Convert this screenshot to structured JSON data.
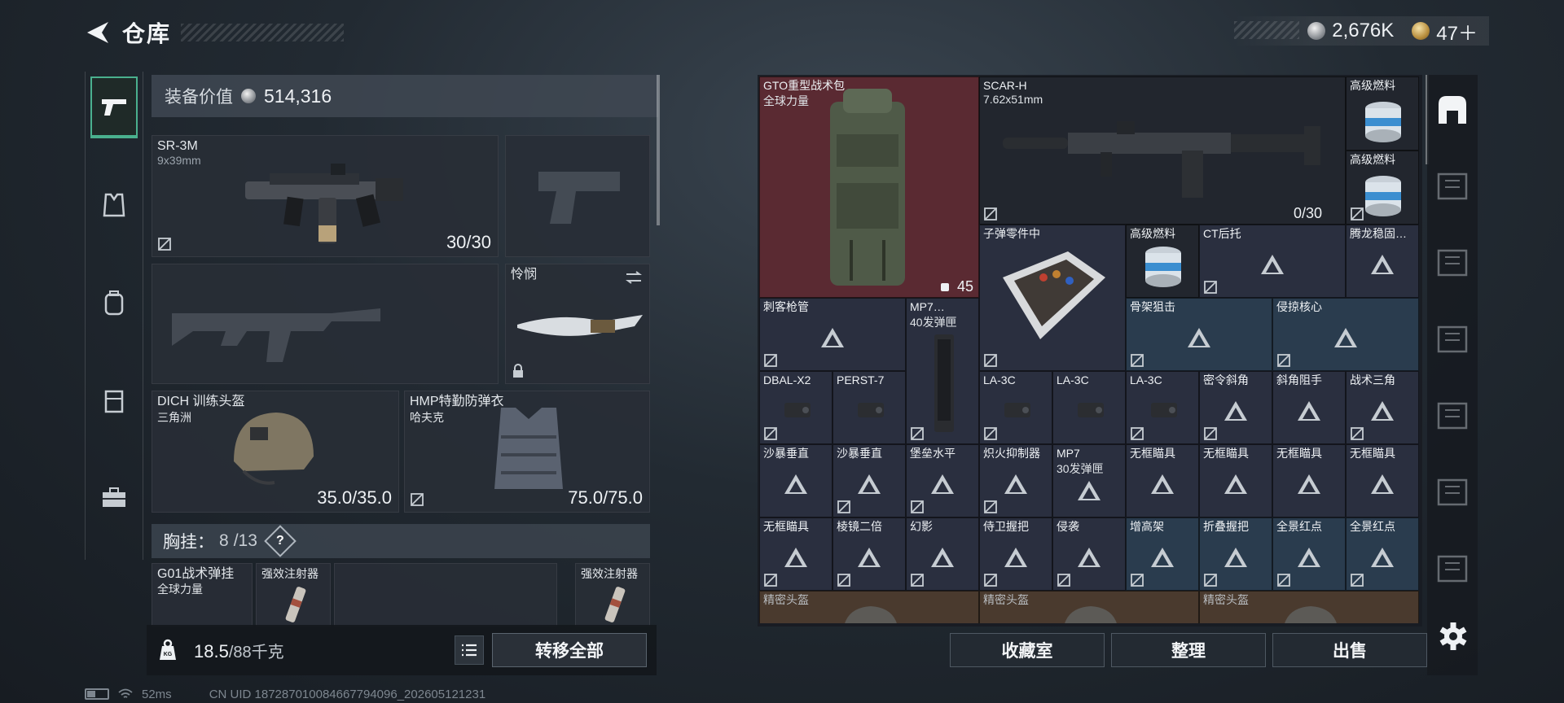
{
  "header": {
    "title": "仓库"
  },
  "currency": {
    "silver": "2,676K",
    "gold": "47＋"
  },
  "loadout": {
    "value_label": "装备价值",
    "value": "514,316",
    "primary": {
      "name": "SR-3M",
      "caliber": "9x39mm",
      "ammo": "30/30"
    },
    "melee": {
      "name": "怜悯"
    },
    "helmet": {
      "name": "DICH 训练头盔",
      "sub": "三角洲",
      "durability": "35.0/35.0"
    },
    "armor": {
      "name": "HMP特勤防弹衣",
      "sub": "哈夫克",
      "durability": "75.0/75.0"
    },
    "rig": {
      "label": "胸挂：",
      "used": "8",
      "total": "/13",
      "help": "?"
    },
    "rig_items": [
      {
        "name": "G01战术弹挂",
        "sub": "全球力量"
      },
      {
        "name": "强效注射器"
      },
      {
        "name": "强效注射器"
      }
    ],
    "weight": {
      "current": "18.5",
      "max": "/88千克"
    },
    "transfer_all": "转移全部"
  },
  "stash": {
    "backpack": {
      "name": "GTO重型战术包",
      "sub": "全球力量",
      "count": "45"
    },
    "scar": {
      "name": "SCAR-H",
      "caliber": "7.62x51mm",
      "ammo": "0/30"
    },
    "fuel": [
      "高级燃料",
      "高级燃料",
      "高级燃料"
    ],
    "parts_box": "子弹零件中",
    "ct_stock": "CT后托",
    "tenglong": "腾龙稳固…",
    "row2": [
      "刺客枪管",
      "骨架狙击",
      "侵掠核心"
    ],
    "mag1": {
      "name": "MP7…",
      "sub": "40发弹匣"
    },
    "row3": [
      "DBAL-X2",
      "PERST-7",
      "LA-3C",
      "LA-3C",
      "LA-3C",
      "密令斜角",
      "斜角阻手",
      "战术三角"
    ],
    "row4": [
      "沙暴垂直",
      "沙暴垂直",
      "堡垒水平",
      "炽火抑制器",
      "无框瞄具",
      "无框瞄具",
      "无框瞄具",
      "无框瞄具"
    ],
    "mag2": {
      "name": "MP7",
      "sub": "30发弹匣"
    },
    "row5": [
      "无框瞄具",
      "棱镜二倍",
      "幻影",
      "侍卫握把",
      "侵袭",
      "增高架",
      "折叠握把",
      "全景红点",
      "全景红点"
    ],
    "row6": [
      "精密头盔",
      "精密头盔",
      "精密头盔"
    ]
  },
  "actions": {
    "collection": "收藏室",
    "sort": "整理",
    "sell": "出售"
  },
  "status": {
    "ping": "52ms",
    "uid": "CN UID 1872870100846677940​96_202605121231"
  },
  "colors": {
    "accent": "#4ab08e",
    "red_cell": "#5a2a32",
    "blue_cell": "#2a3c4e"
  }
}
